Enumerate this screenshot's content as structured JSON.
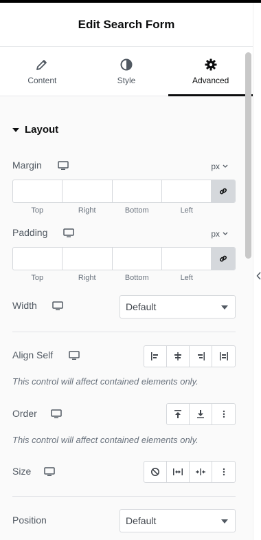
{
  "header": {
    "title": "Edit Search Form"
  },
  "tabs": [
    {
      "label": "Content",
      "icon": "pencil-icon"
    },
    {
      "label": "Style",
      "icon": "contrast-icon"
    },
    {
      "label": "Advanced",
      "icon": "gear-icon"
    }
  ],
  "section": {
    "title": "Layout"
  },
  "margin": {
    "label": "Margin",
    "unit": "px",
    "sides": [
      "Top",
      "Right",
      "Bottom",
      "Left"
    ]
  },
  "padding": {
    "label": "Padding",
    "unit": "px",
    "sides": [
      "Top",
      "Right",
      "Bottom",
      "Left"
    ]
  },
  "width": {
    "label": "Width",
    "value": "Default"
  },
  "align_self": {
    "label": "Align Self",
    "note": "This control will affect contained elements only."
  },
  "order": {
    "label": "Order",
    "note": "This control will affect contained elements only."
  },
  "size": {
    "label": "Size"
  },
  "position": {
    "label": "Position",
    "value": "Default"
  },
  "colors": {
    "active_tab": "#0c0d0e",
    "link_bg": "#d5d8dc",
    "note": "#69727d"
  }
}
